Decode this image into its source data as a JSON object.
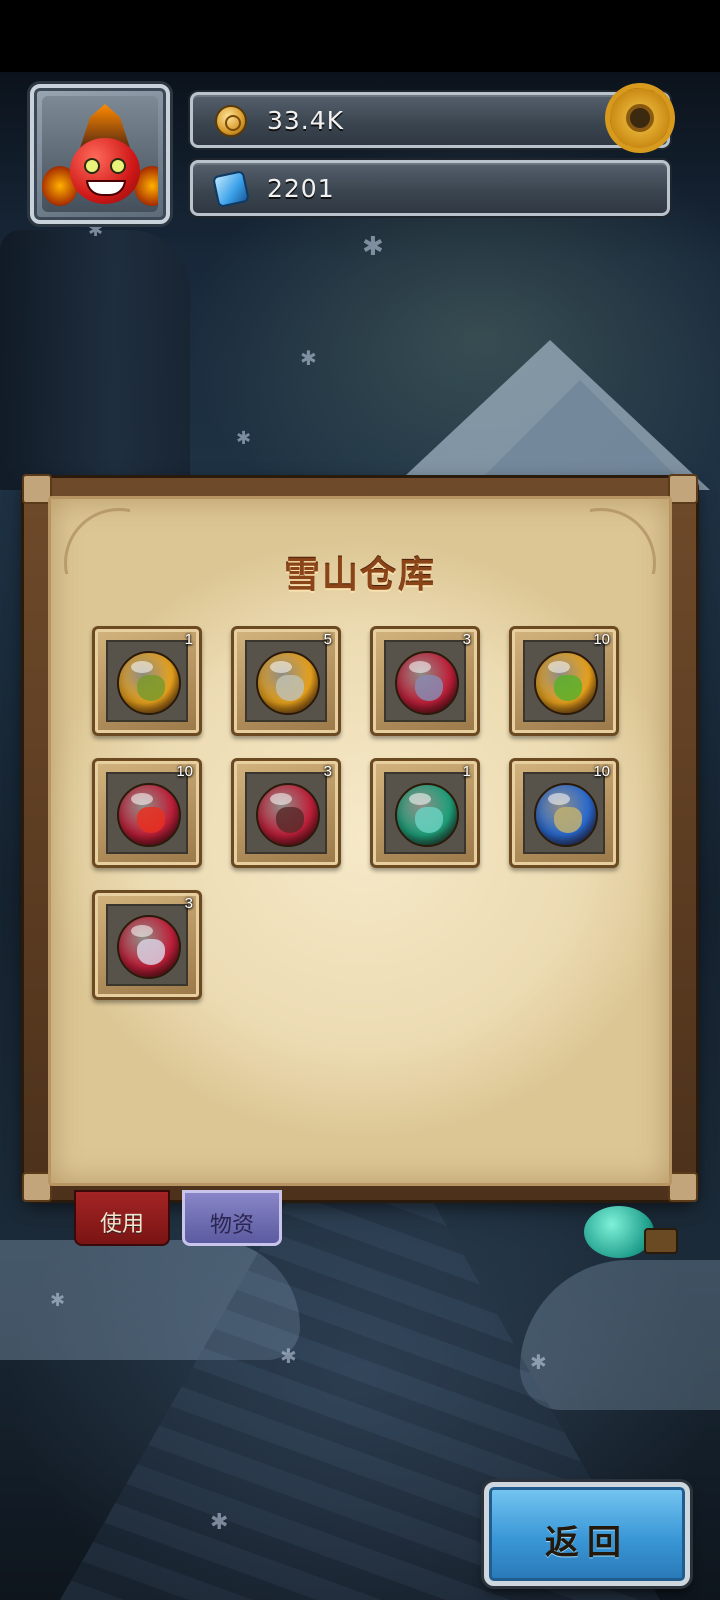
{
  "hud": {
    "coins": "33.4K",
    "gems": "2201",
    "coin_icon": "coin-icon",
    "gem_icon": "gem-icon",
    "settings_icon": "gear-icon"
  },
  "panel": {
    "title": "雪山仓库",
    "items": [
      {
        "count": "1",
        "color": "#e8a21c",
        "face": "#7a9a2a"
      },
      {
        "count": "5",
        "color": "#e8a21c",
        "face": "#c0c0b0"
      },
      {
        "count": "3",
        "color": "#c0203a",
        "face": "#8a8ab0"
      },
      {
        "count": "10",
        "color": "#e8a21c",
        "face": "#5ab02a"
      },
      {
        "count": "10",
        "color": "#c0203a",
        "face": "#e83020"
      },
      {
        "count": "3",
        "color": "#c0203a",
        "face": "#5a2a2a"
      },
      {
        "count": "1",
        "color": "#1ea07a",
        "face": "#6ad0c0"
      },
      {
        "count": "10",
        "color": "#2a6ad0",
        "face": "#c0b070"
      },
      {
        "count": "3",
        "color": "#c0203a",
        "face": "#d8d0e0"
      }
    ]
  },
  "tabs": {
    "use_label": "使用",
    "materials_label": "物资"
  },
  "back_button": {
    "label": "返回"
  },
  "colors": {
    "panel_title": "#8a4418",
    "back_button": "#3a97d6",
    "tab_use": "#a32424",
    "tab_materials": "#8886c8"
  }
}
